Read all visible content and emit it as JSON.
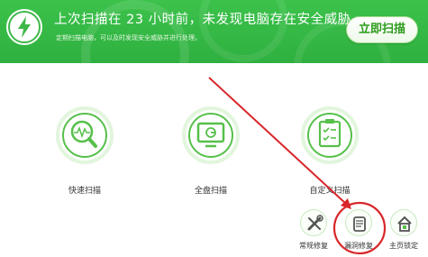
{
  "header": {
    "title": "上次扫描在 23 小时前，未发现电脑存在安全威胁",
    "subtitle": "定期扫描电脑，可以及时发现安全威胁并进行处理。",
    "scan_now_label": "立即扫描"
  },
  "actions": [
    {
      "label": "快速扫描",
      "icon": "magnifier-pulse-icon"
    },
    {
      "label": "全盘扫描",
      "icon": "monitor-icon"
    },
    {
      "label": "自定义扫描",
      "icon": "checklist-clipboard-icon"
    }
  ],
  "tools": [
    {
      "label": "常规修复",
      "icon": "wrench-screwdriver-icon"
    },
    {
      "label": "漏洞修复",
      "icon": "patch-bug-icon"
    },
    {
      "label": "主页锁定",
      "icon": "home-lock-icon"
    }
  ],
  "colors": {
    "header_green": "#36b846",
    "accent_green": "#56c04a",
    "annotation_red": "#d8262a"
  }
}
